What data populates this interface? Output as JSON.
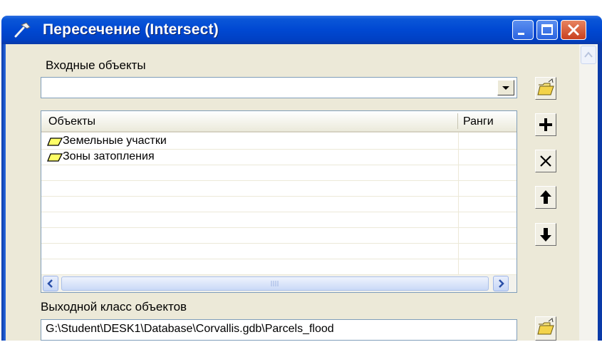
{
  "window": {
    "title": "Пересечение (Intersect)"
  },
  "input_features": {
    "label": "Входные объекты",
    "value": ""
  },
  "table": {
    "columns": [
      "Объекты",
      "Ранги"
    ],
    "rows": [
      {
        "name": "Земельные участки",
        "rank": ""
      },
      {
        "name": "Зоны затопления",
        "rank": ""
      }
    ]
  },
  "output_feature_class": {
    "label": "Выходной класс объектов",
    "value": "G:\\Student\\DESK1\\Database\\Corvallis.gdb\\Parcels_flood"
  },
  "icons": {
    "title": "hammer-icon",
    "browse": "folder-open-icon",
    "add": "plus-icon",
    "remove": "x-icon",
    "up": "arrow-up-icon",
    "down": "arrow-down-icon",
    "layer": "polygon-layer-icon"
  },
  "colors": {
    "titlebar": "#0048d2",
    "close_button": "#c9401f",
    "client": "#ece9d8"
  }
}
